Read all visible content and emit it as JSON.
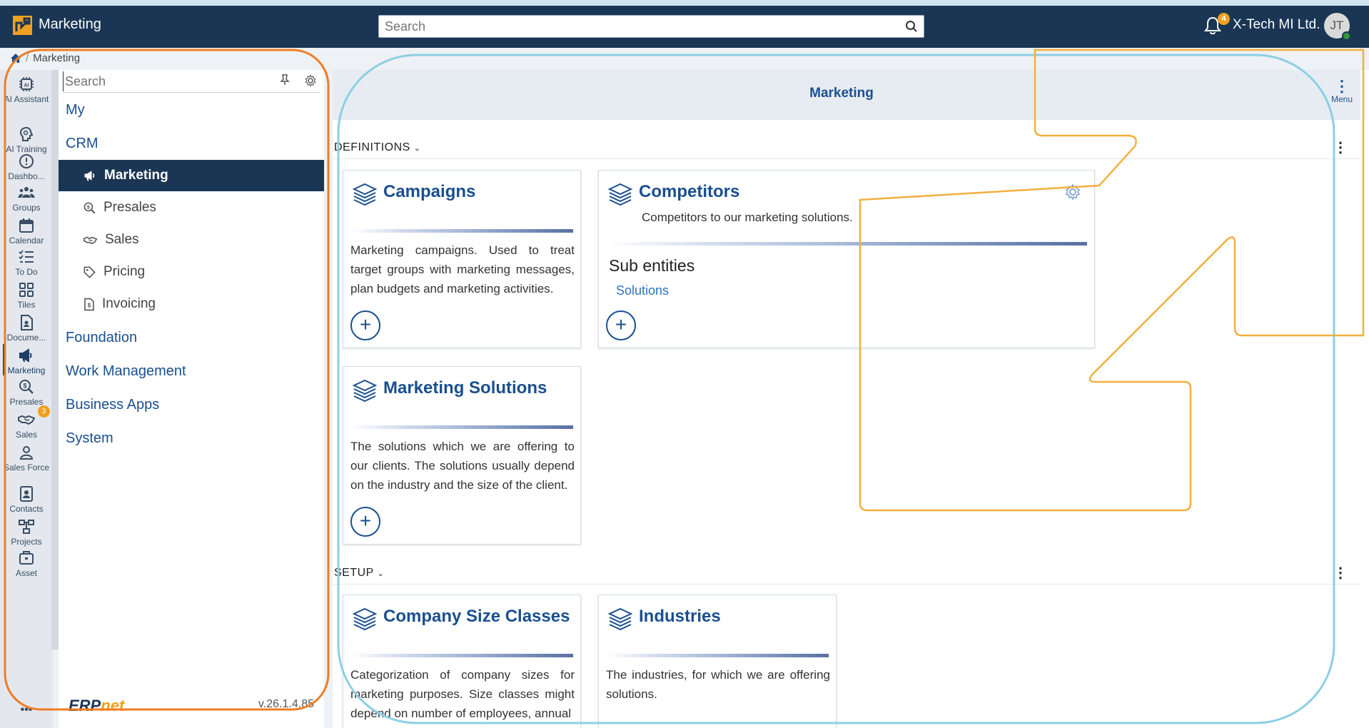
{
  "topbar": {
    "app_title": "Marketing",
    "search_placeholder": "Search",
    "notification_count": "4",
    "company_name": "X-Tech MI Ltd.",
    "avatar_initials": "JT"
  },
  "breadcrumb": {
    "separator": "/",
    "current": "Marketing"
  },
  "rail": {
    "items": [
      {
        "label": "AI Assistant",
        "icon": "ai-chip-icon"
      },
      {
        "label": "AI Training",
        "icon": "ai-training-icon"
      },
      {
        "label": "Dashbo...",
        "icon": "dashboard-icon"
      },
      {
        "label": "Groups",
        "icon": "groups-icon"
      },
      {
        "label": "Calendar",
        "icon": "calendar-icon"
      },
      {
        "label": "To Do",
        "icon": "todo-icon"
      },
      {
        "label": "Tiles",
        "icon": "tiles-icon"
      },
      {
        "label": "Docume...",
        "icon": "document-icon"
      },
      {
        "label": "Marketing",
        "icon": "megaphone-icon"
      },
      {
        "label": "Presales",
        "icon": "presales-icon"
      },
      {
        "label": "Sales",
        "icon": "handshake-icon",
        "badge": "3"
      },
      {
        "label": "Sales Force",
        "icon": "person-icon"
      },
      {
        "label": "Contacts",
        "icon": "contacts-icon"
      },
      {
        "label": "Projects",
        "icon": "projects-icon"
      },
      {
        "label": "Asset",
        "icon": "asset-icon"
      }
    ],
    "more": "•••"
  },
  "nav": {
    "search_placeholder": "Search",
    "groups": {
      "my": "My",
      "crm": "CRM",
      "foundation": "Foundation",
      "work_management": "Work Management",
      "business_apps": "Business Apps",
      "system": "System"
    },
    "crm_items": [
      {
        "label": "Marketing",
        "icon": "megaphone-icon"
      },
      {
        "label": "Presales",
        "icon": "presales-icon"
      },
      {
        "label": "Sales",
        "icon": "handshake-icon"
      },
      {
        "label": "Pricing",
        "icon": "tag-icon"
      },
      {
        "label": "Invoicing",
        "icon": "invoice-icon"
      }
    ],
    "footer_logo_main": "ERP",
    "footer_logo_suffix": "net",
    "version": "v.26.1.4.85"
  },
  "main": {
    "title": "Marketing",
    "menu_label": "Menu",
    "sections": {
      "definitions": "DEFINITIONS",
      "setup": "SETUP"
    },
    "cards": {
      "campaigns": {
        "title": "Campaigns",
        "description": "Marketing campaigns. Used to treat target groups with marketing messages, plan budgets and marketing activities."
      },
      "competitors": {
        "title": "Competitors",
        "subtitle": "Competitors to our marketing solutions.",
        "sub_entities_title": "Sub entities",
        "sub_entity_link": "Solutions"
      },
      "marketing_solutions": {
        "title": "Marketing Solutions",
        "description": "The solutions which we are offering to our clients. The solutions usually depend on the industry and the size of the client."
      },
      "company_size_classes": {
        "title": "Company Size Classes",
        "description": "Categorization of company sizes for marketing purposes. Size classes might depend on number of employees, annual"
      },
      "industries": {
        "title": "Industries",
        "description": "The industries, for which we are offering solutions."
      }
    },
    "add_symbol": "+",
    "kebab_symbol": "⋮"
  },
  "colors": {
    "header_bg": "#1a3654",
    "accent_blue": "#1a4f8f",
    "badge_orange": "#f0a020",
    "annotation_orange": "#f07d22",
    "annotation_cyan": "#8ccfe3",
    "annotation_yellow": "#f2b03c"
  }
}
